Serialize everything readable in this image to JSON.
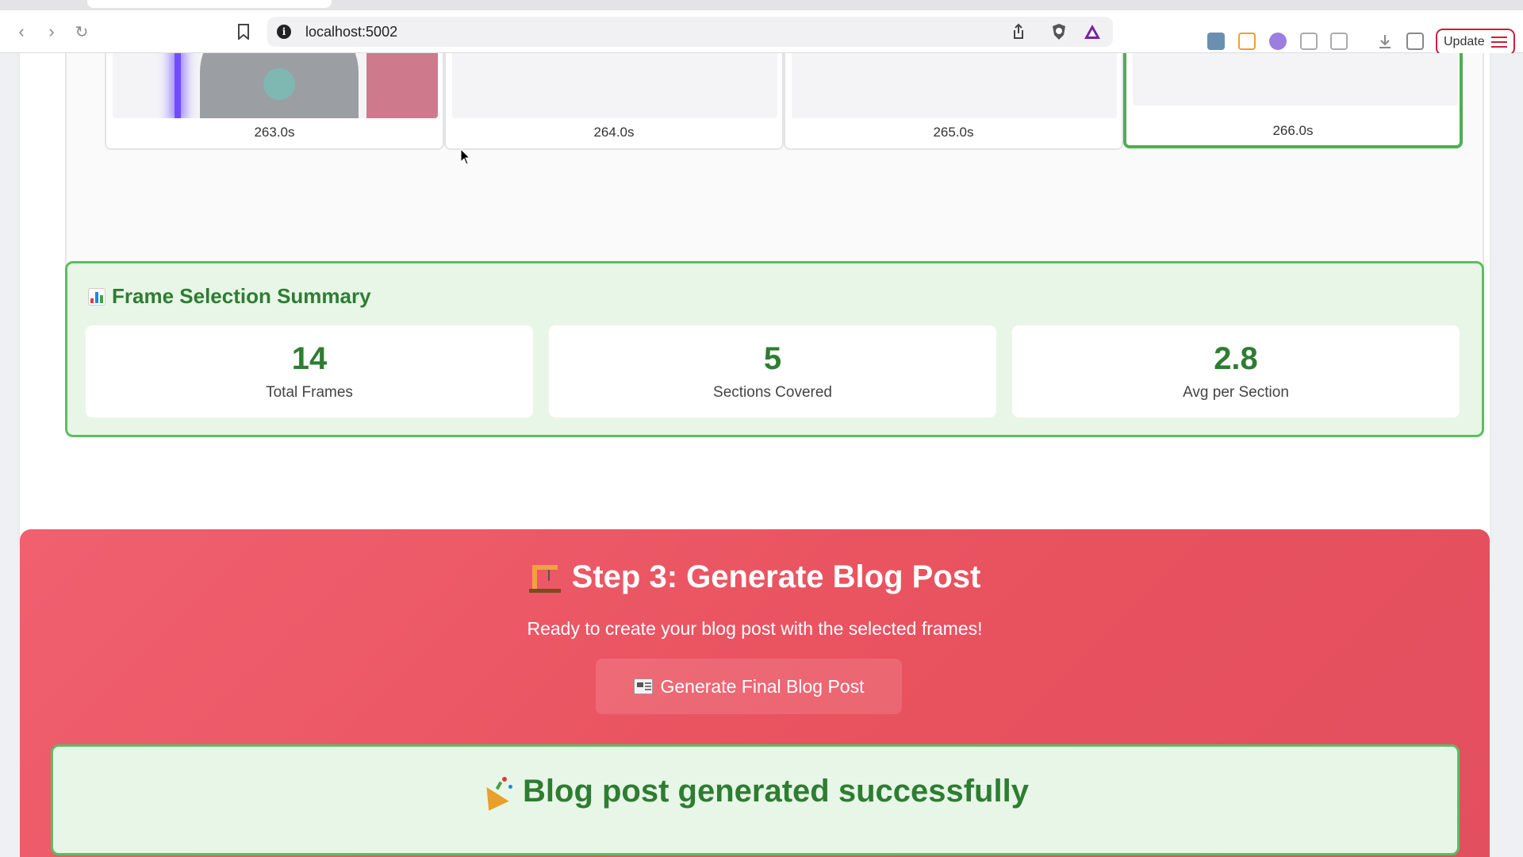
{
  "browser": {
    "url": "localhost:5002",
    "update_label": "Update"
  },
  "frames": [
    {
      "time": "263.0s",
      "selected": false,
      "kind": "video"
    },
    {
      "time": "264.0s",
      "selected": false,
      "kind": "waveform"
    },
    {
      "time": "265.0s",
      "selected": false,
      "kind": "waveform"
    },
    {
      "time": "266.0s",
      "selected": true,
      "kind": "waveform"
    }
  ],
  "summary": {
    "title": "Frame Selection Summary",
    "stats": [
      {
        "value": "14",
        "label": "Total Frames"
      },
      {
        "value": "5",
        "label": "Sections Covered"
      },
      {
        "value": "2.8",
        "label": "Avg per Section"
      }
    ]
  },
  "step3": {
    "title": "Step 3: Generate Blog Post",
    "subtitle": "Ready to create your blog post with the selected frames!",
    "button_label": "Generate Final Blog Post",
    "success_message": "Blog post generated successfully"
  },
  "colors": {
    "success_green": "#2e7d32",
    "success_bg": "#e8f6e7",
    "step3_red": "#e9525f",
    "selected_border": "#4caf50"
  }
}
